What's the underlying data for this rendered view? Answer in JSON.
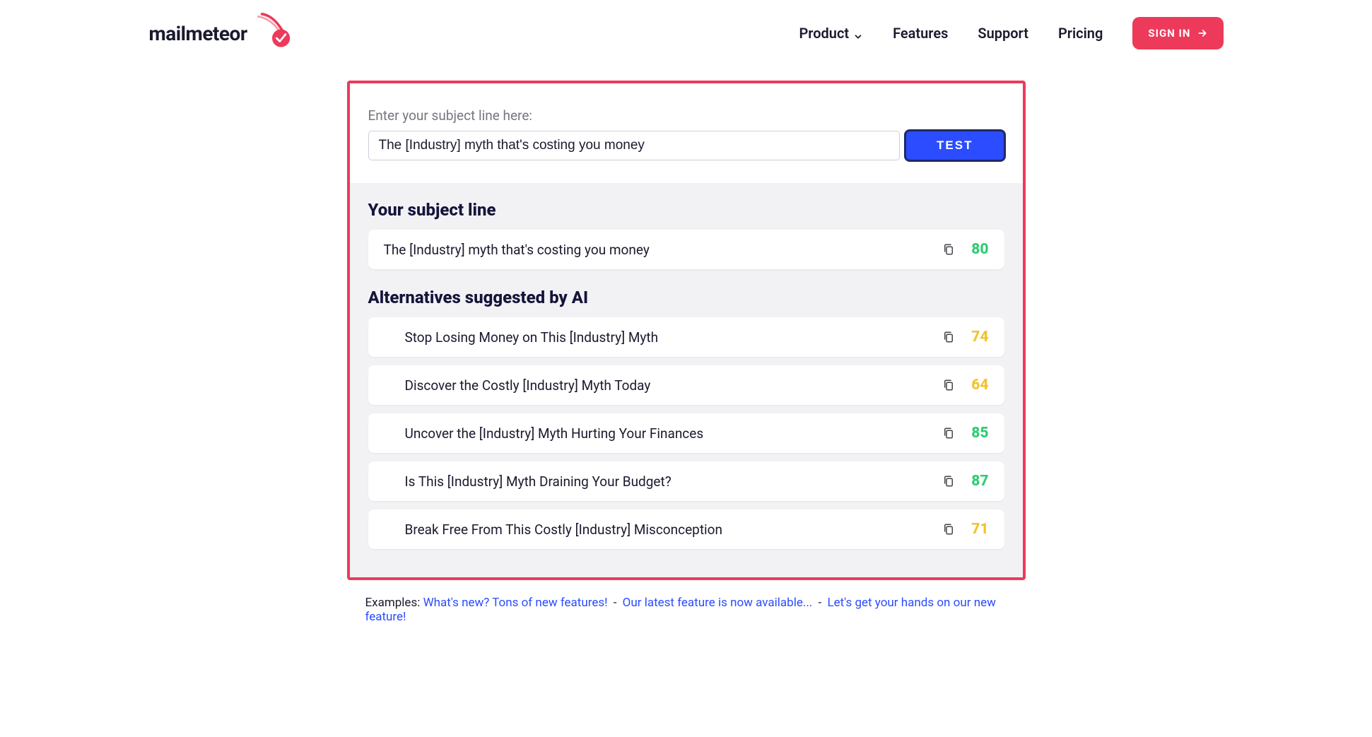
{
  "brand": {
    "name": "mailmeteor"
  },
  "nav": {
    "product": "Product",
    "features": "Features",
    "support": "Support",
    "pricing": "Pricing",
    "signin": "SIGN IN"
  },
  "tool": {
    "label": "Enter your subject line here:",
    "input_value": "The [Industry] myth that's costing you money",
    "test_button": "TEST",
    "section_your": "Your subject line",
    "section_alt": "Alternatives suggested by AI",
    "your_line": {
      "text": "The [Industry] myth that's costing you money",
      "score": "80",
      "score_class": "green"
    },
    "alternatives": [
      {
        "text": "Stop Losing Money on This [Industry] Myth",
        "score": "74",
        "score_class": "yellow"
      },
      {
        "text": "Discover the Costly [Industry] Myth Today",
        "score": "64",
        "score_class": "yellow"
      },
      {
        "text": "Uncover the [Industry] Myth Hurting Your Finances",
        "score": "85",
        "score_class": "green"
      },
      {
        "text": "Is This [Industry] Myth Draining Your Budget?",
        "score": "87",
        "score_class": "green"
      },
      {
        "text": "Break Free From This Costly [Industry] Misconception",
        "score": "71",
        "score_class": "yellow"
      }
    ]
  },
  "examples": {
    "label": "Examples:",
    "items": [
      "What's new? Tons of new features!",
      "Our latest feature is now available...",
      "Let's get your hands on our new feature!"
    ]
  }
}
